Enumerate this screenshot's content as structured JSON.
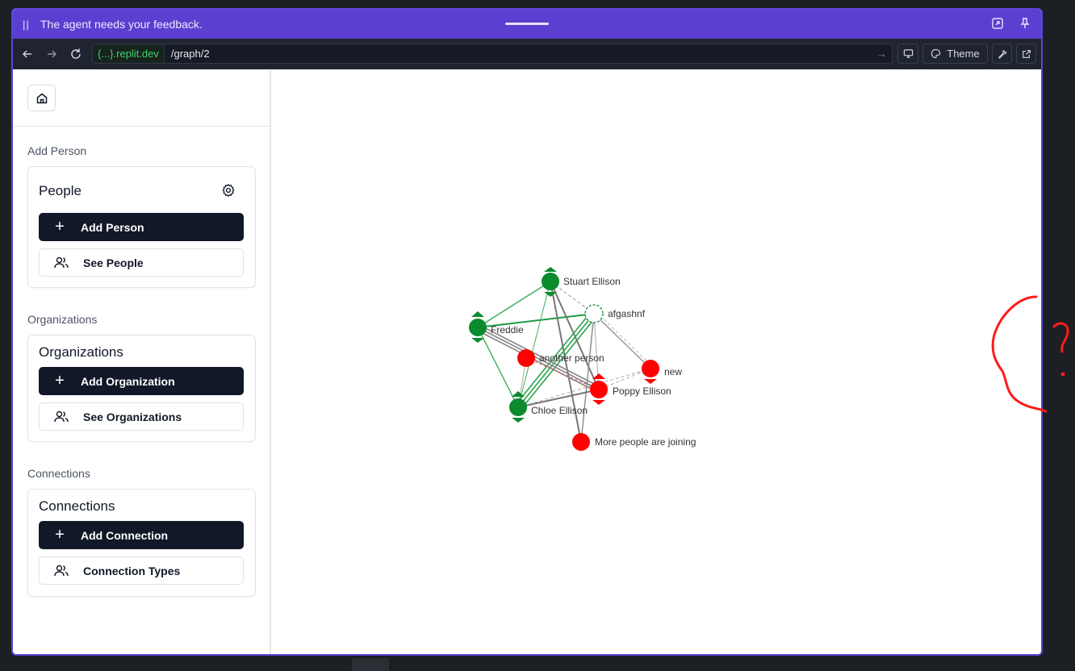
{
  "banner": {
    "pause_icon": "pause-icon",
    "message": "The agent needs your feedback."
  },
  "urlbar": {
    "host": "{...}.replit.dev",
    "path": "/graph/2",
    "theme_label": "Theme"
  },
  "sidebar": {
    "add_person_section": "Add Person",
    "people_card": {
      "title": "People",
      "primary": "Add Person",
      "secondary": "See People"
    },
    "organizations_section": "Organizations",
    "organizations_card": {
      "title": "Organizations",
      "primary": "Add Organization",
      "secondary": "See Organizations"
    },
    "connections_section": "Connections",
    "connections_card": {
      "title": "Connections",
      "primary": "Add Connection",
      "secondary": "Connection Types"
    }
  },
  "graph": {
    "nodes": [
      {
        "id": "stuart",
        "label": "Stuart Ellison",
        "color": "#0b8a2e",
        "style": "solid"
      },
      {
        "id": "afgashnf",
        "label": "afgashnf",
        "color": "#0b8a2e",
        "style": "dashed"
      },
      {
        "id": "freddie",
        "label": "Freddie",
        "color": "#0b8a2e",
        "style": "solid"
      },
      {
        "id": "another",
        "label": "another person",
        "color": "#ff0000",
        "style": "solid"
      },
      {
        "id": "new",
        "label": "new",
        "color": "#ff0000",
        "style": "solid"
      },
      {
        "id": "poppy",
        "label": "Poppy Ellison",
        "color": "#ff0000",
        "style": "solid"
      },
      {
        "id": "chloe",
        "label": "Chloe Ellison",
        "color": "#0b8a2e",
        "style": "solid"
      },
      {
        "id": "more",
        "label": "More people are joining",
        "color": "#ff0000",
        "style": "solid"
      }
    ]
  },
  "colors": {
    "accent": "#5b3fd0",
    "green": "#0b8a2e",
    "red": "#ff0000",
    "dark_button": "#111827"
  }
}
